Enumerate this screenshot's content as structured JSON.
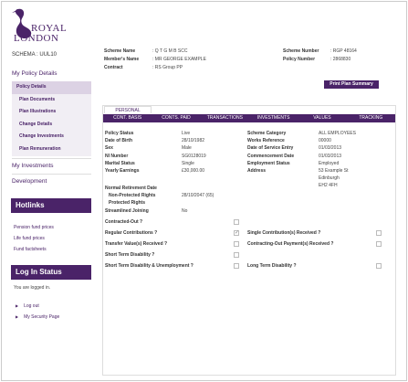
{
  "brand": {
    "line1": "ROYAL",
    "line2": "LONDON"
  },
  "schema": "SCHEMA : UUL10",
  "nav": {
    "my_policy_details": "My Policy Details",
    "sub_items": [
      "Policy Details",
      "Plan Documents",
      "Plan Illustrations",
      "Change Details",
      "Change Investments",
      "Plan Remuneration"
    ],
    "my_investments": "My Investments",
    "development": "Development"
  },
  "hotlinks": {
    "title": "Hotlinks",
    "links": [
      "Pension fund prices",
      "Life fund prices",
      "Fund factsheets"
    ]
  },
  "login_status": {
    "title": "Log In Status",
    "message": "You are logged in.",
    "links": [
      "Log out",
      "My Security Page"
    ]
  },
  "header": {
    "scheme_name_label": "Scheme Name",
    "scheme_name_value": ": Q T G M B SCC",
    "member_name_label": "Member's Name",
    "member_name_value": ": MR GEORGE EXAMPLE",
    "contract_label": "Contract",
    "contract_value": ": RS Group PP",
    "scheme_number_label": "Scheme Number",
    "scheme_number_value": ": RGP 48164",
    "policy_number_label": "Policy Number",
    "policy_number_value": ": 2868830"
  },
  "print_button": "Print Plan Summary",
  "personal_tab": "PERSONAL",
  "tabs": [
    "CONT. BASIS",
    "CONTS. PAID",
    "TRANSACTIONS",
    "INVESTMENTS",
    "VALUES",
    "TRACKING"
  ],
  "details_left": [
    {
      "label": "Policy Status",
      "value": "Live"
    },
    {
      "label": "Date of Birth",
      "value": "28/10/1982"
    },
    {
      "label": "Sex",
      "value": "Male"
    },
    {
      "label": "NI Number",
      "value": "SG0128019"
    },
    {
      "label": "Marital Status",
      "value": "Single"
    },
    {
      "label": "Yearly Earnings",
      "value": "£30,000.00"
    }
  ],
  "details_right": [
    {
      "label": "Scheme Category",
      "value": "ALL EMPLOYEES"
    },
    {
      "label": "Works Reference",
      "value": "00000"
    },
    {
      "label": "Date of Service Entry",
      "value": "01/03/2013"
    },
    {
      "label": "Commencement Date",
      "value": "01/03/2013"
    },
    {
      "label": "Employment Status",
      "value": "Employed"
    },
    {
      "label": "Address",
      "value": "53 Example St"
    }
  ],
  "address_lines": [
    "Edinburgh",
    "EH2 4FH"
  ],
  "retirement": {
    "heading": "Normal Retirement Date",
    "non_protected_label": "Non-Protected Rights",
    "non_protected_value": "28/10/2047 (65)",
    "protected_label": "Protected Rights",
    "protected_value": "",
    "streamlined_label": "Streamlined Joining",
    "streamlined_value": "No"
  },
  "checks_left": [
    {
      "label": "Contracted-Out ?",
      "checked": false
    },
    {
      "label": "Regular Contributions ?",
      "checked": true
    },
    {
      "label": "Transfer Value(s) Received ?",
      "checked": false
    },
    {
      "label": "Short Term Disability ?",
      "checked": false
    },
    {
      "label": "Short Term Disability & Unemployment ?",
      "checked": false
    }
  ],
  "checks_right": [
    {
      "label": "Single Contribution(s) Received ?",
      "checked": false
    },
    {
      "label": "Contracting-Out Payment(s) Received ?",
      "checked": false
    },
    {
      "label": "Long Term Disability ?",
      "checked": false
    }
  ],
  "colors": {
    "brand": "#4a2368",
    "nav_bg": "#f1eef4",
    "nav_active": "#dcd2e4"
  },
  "icons": [
    "pelican-logo-icon",
    "triangle-bullet-icon"
  ]
}
